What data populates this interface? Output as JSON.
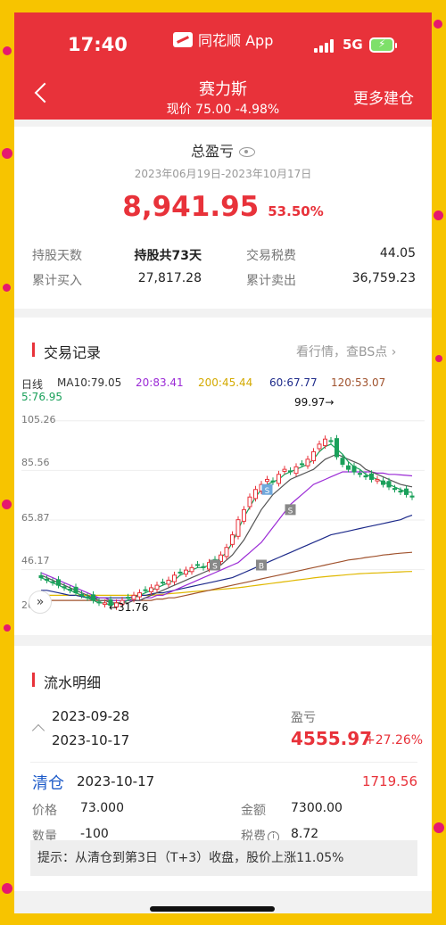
{
  "status_bar": {
    "time": "17:40",
    "app_name": "同花顺 App",
    "network": "5G",
    "signal_icon": "signal-bars-icon",
    "battery_icon": "battery-charging-icon"
  },
  "header": {
    "title": "赛力斯",
    "subtitle": "现价 75.00 -4.98%",
    "more_label": "更多建仓",
    "back_icon": "back-arrow-icon"
  },
  "summary": {
    "title": "总盈亏",
    "eye_icon": "eye-icon",
    "date_range": "2023年06月19日-2023年10月17日",
    "total": "8,941.95",
    "total_pct": "53.50%",
    "rows": [
      {
        "label": "持股天数",
        "value": "持股共73天",
        "label2": "交易税费",
        "value2": "44.05"
      },
      {
        "label": "累计买入",
        "value": "27,817.28",
        "label2": "累计卖出",
        "value2": "36,759.23"
      }
    ]
  },
  "trades": {
    "title": "交易记录",
    "link": "看行情，查BS点",
    "legend": {
      "period": "日线",
      "ma10": "MA10:79.05",
      "ma20": "20:83.41",
      "ma200": "200:45.44",
      "ma60": "60:67.77",
      "ma120": "120:53.07",
      "ma5": "5:76.95"
    },
    "axis_labels": [
      "105.26",
      "85.56",
      "65.87",
      "46.17",
      "26"
    ],
    "high_label": "99.97→",
    "low_label": "←31.76",
    "markers": [
      "S",
      "S",
      "S",
      "B"
    ],
    "expand_icon": "double-chevron-icon"
  },
  "chart_data": {
    "type": "candlestick",
    "y_ticks": [
      105.26,
      85.56,
      65.87,
      46.17,
      26
    ],
    "high": 99.97,
    "low": 31.76,
    "closes": [
      43,
      42,
      41,
      40,
      39,
      38,
      37,
      36,
      35,
      34,
      33,
      33,
      32,
      33,
      34,
      35,
      36,
      37,
      38,
      39,
      40,
      41,
      42,
      44,
      45,
      46,
      47,
      48,
      47,
      49,
      50,
      52,
      55,
      60,
      66,
      70,
      75,
      78,
      80,
      82,
      81,
      84,
      86,
      85,
      87,
      88,
      90,
      93,
      96,
      98,
      97,
      91,
      88,
      86,
      85,
      84,
      83,
      82,
      82,
      80,
      79,
      78,
      77,
      76,
      75
    ],
    "ma5": [
      43,
      42,
      41,
      40,
      39,
      38,
      37,
      36,
      35,
      34,
      33,
      33,
      32,
      33,
      33,
      34,
      35,
      36,
      37,
      38,
      39,
      40,
      41,
      42,
      44,
      45,
      46,
      47,
      47,
      48,
      49,
      51,
      53,
      57,
      62,
      67,
      71,
      75,
      78,
      80,
      81,
      82,
      84,
      85,
      86,
      87,
      88,
      90,
      93,
      95,
      96,
      94,
      92,
      89,
      87,
      86,
      84,
      83,
      82,
      81,
      80,
      79,
      78,
      77,
      76.95
    ],
    "ma10": [
      44,
      43,
      42,
      41,
      40,
      39,
      38,
      37,
      36,
      35,
      34,
      34,
      33,
      33,
      33,
      33,
      34,
      34,
      35,
      36,
      37,
      38,
      39,
      40,
      41,
      42,
      43,
      44,
      45,
      46,
      47,
      48,
      50,
      52,
      55,
      58,
      62,
      66,
      70,
      73,
      76,
      78,
      80,
      82,
      83,
      84,
      85,
      86,
      88,
      90,
      91,
      92,
      91,
      90,
      89,
      88,
      86,
      85,
      84,
      83,
      82,
      81,
      80,
      79.5,
      79.05
    ],
    "ma20": [
      45,
      44,
      43,
      42,
      41,
      40,
      39,
      38,
      37,
      36,
      35,
      35,
      34,
      34,
      34,
      34,
      34,
      34,
      35,
      35,
      36,
      36,
      37,
      38,
      39,
      40,
      41,
      42,
      43,
      44,
      45,
      46,
      47,
      48,
      49,
      51,
      53,
      55,
      57,
      60,
      63,
      66,
      69,
      72,
      74,
      76,
      78,
      80,
      81,
      82,
      83,
      84,
      85,
      85,
      85,
      85,
      85,
      85,
      84.5,
      84.5,
      84,
      84,
      83.8,
      83.6,
      83.41
    ],
    "ma60": [
      38,
      38,
      37.5,
      37,
      36.5,
      36,
      36,
      35.5,
      35,
      35,
      35,
      35,
      35,
      35,
      35,
      35,
      35.5,
      36,
      36,
      36.5,
      37,
      37,
      37.5,
      38,
      38.5,
      39,
      39.5,
      40,
      40.5,
      41,
      41.5,
      42,
      42.5,
      43,
      44,
      45,
      46,
      47,
      48,
      49,
      50,
      51,
      52,
      53,
      54,
      55,
      56,
      57,
      58,
      59,
      60,
      60.5,
      61,
      61.5,
      62,
      62.5,
      63,
      63.5,
      64,
      64.5,
      65,
      65.5,
      66,
      67,
      67.77
    ],
    "ma120": [
      34,
      34,
      34,
      34,
      34,
      34,
      34,
      34,
      34,
      34,
      34,
      34,
      34,
      34,
      34,
      34,
      34,
      34,
      34,
      34,
      34.5,
      34.5,
      35,
      35,
      35.5,
      36,
      36.5,
      37,
      37.5,
      38,
      38.5,
      39,
      39.5,
      40,
      40.5,
      41,
      41.5,
      42,
      42.5,
      43,
      43.5,
      44,
      44.5,
      45,
      45.5,
      46,
      46.5,
      47,
      47.5,
      48,
      48.5,
      49,
      49.5,
      50,
      50.3,
      50.6,
      51,
      51.3,
      51.6,
      52,
      52.2,
      52.5,
      52.7,
      52.9,
      53.07
    ],
    "ma200": [
      36,
      36,
      36,
      36,
      36,
      36,
      36,
      36,
      36,
      36,
      36,
      36,
      36,
      36,
      36,
      36,
      36,
      36,
      36,
      36,
      36.2,
      36.4,
      36.6,
      36.8,
      37,
      37.2,
      37.4,
      37.6,
      37.8,
      38,
      38.2,
      38.4,
      38.6,
      38.8,
      39,
      39.3,
      39.6,
      39.9,
      40.2,
      40.5,
      40.8,
      41.1,
      41.4,
      41.7,
      42,
      42.3,
      42.6,
      42.9,
      43.2,
      43.4,
      43.6,
      43.8,
      44,
      44.2,
      44.4,
      44.6,
      44.7,
      44.8,
      44.9,
      45,
      45.1,
      45.2,
      45.3,
      45.4,
      45.44
    ],
    "colors": {
      "ma5": "#1aa05a",
      "ma10": "#555555",
      "ma20": "#9b2bd6",
      "ma60": "#1d2a8a",
      "ma120": "#a0522d",
      "ma200": "#e0b800",
      "up": "#e8323a",
      "down": "#1aa05a"
    }
  },
  "flow": {
    "title": "流水明细",
    "date_from": "2023-09-28",
    "date_to": "2023-10-17",
    "pl_label": "盈亏",
    "pl_value": "4555.97",
    "pl_pct": "+27.26%",
    "collapse_icon": "chevron-up-icon",
    "record": {
      "type": "清仓",
      "date": "2023-10-17",
      "amount_right": "1719.56",
      "price_label": "价格",
      "price": "73.000",
      "total_label": "金额",
      "total": "7300.00",
      "qty_label": "数量",
      "qty": "-100",
      "fee_label": "税费",
      "fee": "8.72",
      "info_icon": "info-icon"
    },
    "hint": "提示：从清仓到第3日（T+3）收盘，股价上涨11.05%"
  }
}
